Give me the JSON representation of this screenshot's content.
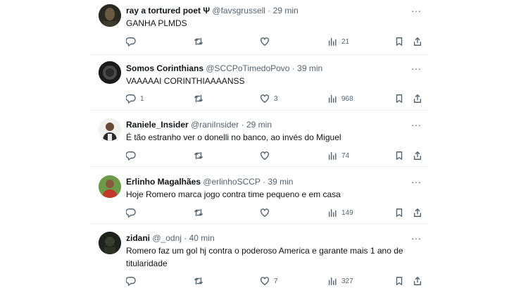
{
  "tweets": [
    {
      "name": "ray a tortured poet Ψ",
      "handle": "@favsgrussell",
      "sep": "·",
      "time": "29 min",
      "text": "GANHA PLMDS",
      "replies": "",
      "retweets": "",
      "likes": "",
      "views": "21",
      "avatar_color": "#2a2a22"
    },
    {
      "name": "Somos Corinthians",
      "handle": "@SCCPoTimedoPovo",
      "sep": "·",
      "time": "39 min",
      "text": "VAAAAAI CORINTHIAAAANSS",
      "replies": "1",
      "retweets": "",
      "likes": "3",
      "views": "968",
      "avatar_color": "#1a1a1a"
    },
    {
      "name": "Raniele_Insider",
      "handle": "@raniInsider",
      "sep": "·",
      "time": "29 min",
      "text": "É tão estranho ver o donelli no banco, ao invés do Miguel",
      "replies": "",
      "retweets": "",
      "likes": "",
      "views": "74",
      "avatar_color": "#e8e6e2"
    },
    {
      "name": "Erlinho Magalhães",
      "handle": "@erlinhoSCCP",
      "sep": "·",
      "time": "39 min",
      "text": "Hoje Romero marca jogo contra time pequeno e em casa",
      "replies": "",
      "retweets": "",
      "likes": "",
      "views": "149",
      "avatar_color": "#5c8a3a"
    },
    {
      "name": "zidani",
      "handle": "@_odnj",
      "sep": "·",
      "time": "40 min",
      "text": "Romero faz um gol hj contra o poderoso America e garante mais 1 ano de titularidade",
      "replies": "",
      "retweets": "",
      "likes": "7",
      "views": "327",
      "avatar_color": "#1e241c"
    }
  ],
  "more_glyph": "···"
}
